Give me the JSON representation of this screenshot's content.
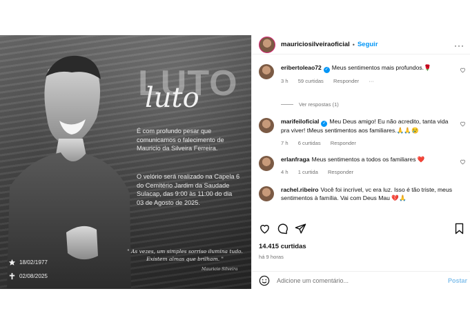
{
  "header": {
    "username": "mauriciosilveiraoficial",
    "separator": "•",
    "follow_label": "Seguir",
    "more_label": "···"
  },
  "image": {
    "title_outline": "LUTO",
    "title_script": "luto",
    "paragraph1": "É com profundo pesar que comunicamos o falecimento de Mauricio da Silveira Ferreira.",
    "paragraph2": "O velório será realizado na Capela 6 do Cemitério Jardim da Saudade Sulacap, das 9:00 às 11:00 do dia 03 de Agosto de 2025.",
    "quote": "\" As vezes, um simples sorriso ilumina tudo. Existem almas que brilham. \"",
    "signature": "Mauricio Silveira",
    "birth_date": "18/02/1977",
    "death_date": "02/08/2025"
  },
  "comments": [
    {
      "username": "eribertoleao72",
      "verified": true,
      "text": "Meus sentimentos mais profundos.🌹",
      "time": "3 h",
      "likes": "59 curtidas",
      "reply": "Responder",
      "more": "···",
      "view_replies": "Ver respostas (1)"
    },
    {
      "username": "marifeiloficial",
      "verified": true,
      "text": "Meu Deus amigo! Eu não acredito, tanta vida pra viver! tMeus sentimentos aos familiares.🙏🙏😢",
      "time": "7 h",
      "likes": "6 curtidas",
      "reply": "Responder"
    },
    {
      "username": "erlanfraga",
      "verified": false,
      "text": "Meus sentimentos a todos os familiares ❤️",
      "time": "4 h",
      "likes": "1 curtida",
      "reply": "Responder"
    },
    {
      "username": "rachel.ribeiro",
      "verified": false,
      "text": "Você foi incrível, vc era luz. Isso é tão triste, meus sentimentos à família. Vai com Deus Mau 💔🙏",
      "time": "",
      "likes": "",
      "reply": ""
    }
  ],
  "stats": {
    "likes": "14.415 curtidas",
    "time_ago": "há 9 horas"
  },
  "composer": {
    "placeholder": "Adicione um comentário...",
    "post_label": "Postar"
  },
  "colors": {
    "accent": "#0095f6",
    "heart_red": "#ed4956",
    "muted": "#737373"
  }
}
